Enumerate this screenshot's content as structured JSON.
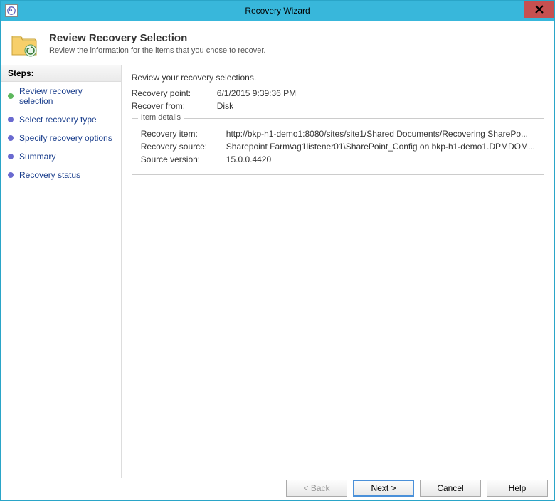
{
  "window": {
    "title": "Recovery Wizard"
  },
  "header": {
    "title": "Review Recovery Selection",
    "subtitle": "Review the information for the items that you chose to recover."
  },
  "sidebar": {
    "title": "Steps:",
    "steps": [
      {
        "label": "Review recovery selection",
        "state": "active"
      },
      {
        "label": "Select recovery type",
        "state": "pending"
      },
      {
        "label": "Specify recovery options",
        "state": "pending"
      },
      {
        "label": "Summary",
        "state": "pending"
      },
      {
        "label": "Recovery status",
        "state": "pending"
      }
    ]
  },
  "main": {
    "intro": "Review your recovery selections.",
    "recovery_point_label": "Recovery point:",
    "recovery_point_value": "6/1/2015 9:39:36 PM",
    "recover_from_label": "Recover from:",
    "recover_from_value": "Disk",
    "item_details": {
      "title": "Item details",
      "recovery_item_label": "Recovery item:",
      "recovery_item_value": "http://bkp-h1-demo1:8080/sites/site1/Shared Documents/Recovering SharePo...",
      "recovery_source_label": "Recovery source:",
      "recovery_source_value": "Sharepoint Farm\\ag1listener01\\SharePoint_Config on bkp-h1-demo1.DPMDOM...",
      "source_version_label": "Source version:",
      "source_version_value": "15.0.0.4420"
    }
  },
  "buttons": {
    "back": "< Back",
    "next": "Next >",
    "cancel": "Cancel",
    "help": "Help"
  }
}
